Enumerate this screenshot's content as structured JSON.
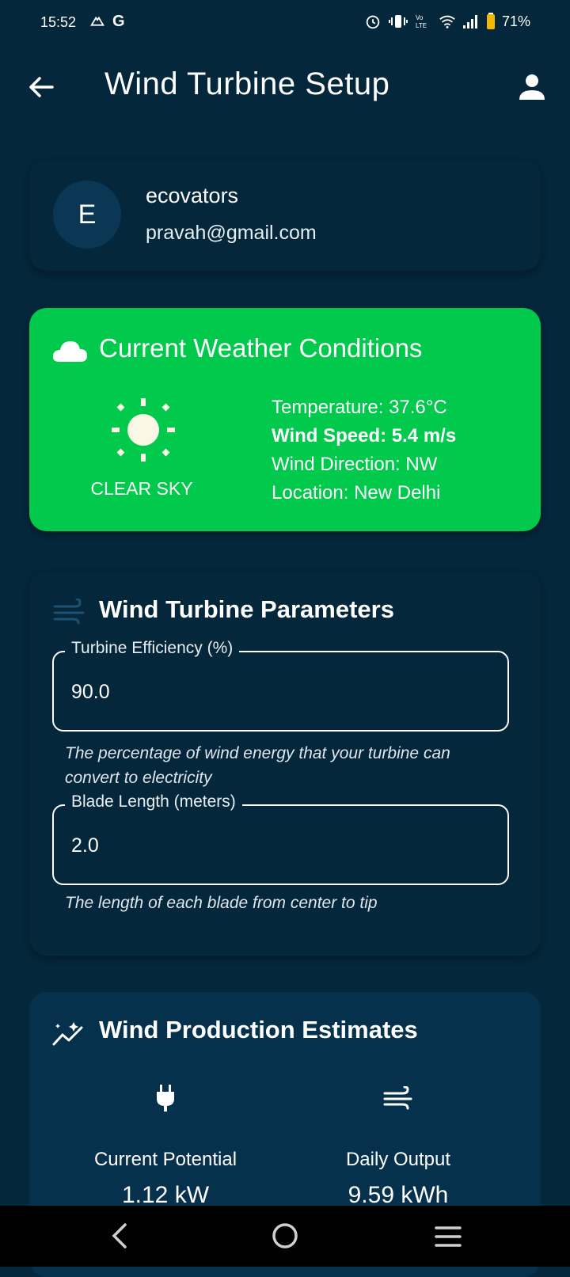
{
  "status_bar": {
    "time": "15:52",
    "battery": "71%"
  },
  "app_bar": {
    "title": "Wind Turbine Setup"
  },
  "profile": {
    "initial": "E",
    "name": "ecovators",
    "email": "pravah@gmail.com"
  },
  "weather": {
    "title": "Current Weather Conditions",
    "condition": "CLEAR SKY",
    "temperature": "Temperature: 37.6°C",
    "wind_speed": "Wind Speed: 5.4 m/s",
    "wind_direction": "Wind Direction: NW",
    "location": "Location: New Delhi",
    "card_color": "#00c94c"
  },
  "parameters": {
    "title": "Wind Turbine Parameters",
    "efficiency_label": "Turbine Efficiency (%)",
    "efficiency_value": "90.0",
    "efficiency_helper": "The percentage of wind energy that your turbine can convert to electricity",
    "blade_label": "Blade Length (meters)",
    "blade_value": "2.0",
    "blade_helper": "The length of each blade from center to tip"
  },
  "estimates": {
    "title": "Wind Production Estimates",
    "current_label": "Current Potential",
    "current_value": "1.12 kW",
    "daily_label": "Daily Output",
    "daily_value": "9.59 kWh"
  },
  "colors": {
    "background": "#04273b",
    "accent_green": "#00c94c",
    "estimates_card": "#06314d"
  }
}
